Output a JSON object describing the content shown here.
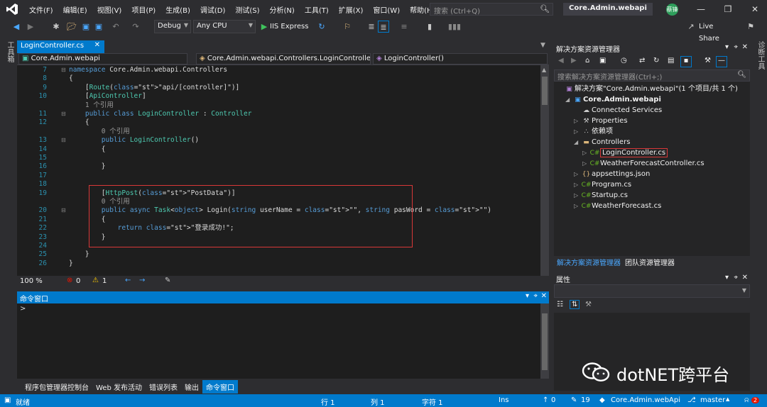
{
  "menu": [
    "文件(F)",
    "编辑(E)",
    "视图(V)",
    "项目(P)",
    "生成(B)",
    "调试(D)",
    "测试(S)",
    "分析(N)",
    "工具(T)",
    "扩展(X)",
    "窗口(W)",
    "帮助(H)"
  ],
  "search": {
    "placeholder": "搜索 (Ctrl+Q)"
  },
  "project_title": "Core.Admin.webapi",
  "avatar": "蔡锋",
  "toolbar": {
    "config": "Debug",
    "platform": "Any CPU",
    "run_label": "IIS Express",
    "live_share": "Live Share"
  },
  "left_strip": "工具箱",
  "right_strip": "诊断工具",
  "editor": {
    "tab": "LoginController.cs",
    "nav_project": "Core.Admin.webapi",
    "nav_class": "Core.Admin.webapi.Controllers.LoginController",
    "nav_member": "LoginController()",
    "lines": [
      {
        "n": "7",
        "text": "namespace Core.Admin.webapi.Controllers"
      },
      {
        "n": "8",
        "text": "{"
      },
      {
        "n": "9",
        "text": "    [Route(\"api/[controller]\")]"
      },
      {
        "n": "10",
        "text": "    [ApiController]"
      },
      {
        "n": "",
        "text": "    1 个引用"
      },
      {
        "n": "11",
        "text": "    public class LoginController : Controller"
      },
      {
        "n": "12",
        "text": "    {"
      },
      {
        "n": "",
        "text": "        0 个引用"
      },
      {
        "n": "13",
        "text": "        public LoginController()"
      },
      {
        "n": "14",
        "text": "        {"
      },
      {
        "n": "15",
        "text": ""
      },
      {
        "n": "16",
        "text": "        }"
      },
      {
        "n": "17",
        "text": ""
      },
      {
        "n": "18",
        "text": ""
      },
      {
        "n": "19",
        "text": "        [HttpPost(\"PostData\")]"
      },
      {
        "n": "",
        "text": "        0 个引用"
      },
      {
        "n": "20",
        "text": "        public async Task<object> Login(string userName = \"\", string pasWord = \"\")"
      },
      {
        "n": "21",
        "text": "        {"
      },
      {
        "n": "22",
        "text": "            return \"登录成功!\";"
      },
      {
        "n": "23",
        "text": "        }"
      },
      {
        "n": "24",
        "text": ""
      },
      {
        "n": "25",
        "text": "    }"
      },
      {
        "n": "26",
        "text": "}"
      }
    ],
    "zoom": "100 %",
    "errors": "0",
    "warnings": "1"
  },
  "command_window": {
    "title": "命令窗口",
    "prompt": ">"
  },
  "bottom_tabs": [
    "程序包管理器控制台",
    "Web 发布活动",
    "错误列表",
    "输出",
    "命令窗口"
  ],
  "solution_explorer": {
    "title": "解决方案资源管理器",
    "search_placeholder": "搜索解决方案资源管理器(Ctrl+;)",
    "items": [
      {
        "label": "解决方案\"Core.Admin.webapi\"(1 个项目/共 1 个)",
        "level": 0,
        "icon": "solution-icon"
      },
      {
        "label": "Core.Admin.webapi",
        "level": 1,
        "icon": "project-icon",
        "bold": true
      },
      {
        "label": "Connected Services",
        "level": 2,
        "icon": "connected-services-icon"
      },
      {
        "label": "Properties",
        "level": 2,
        "icon": "wrench-icon"
      },
      {
        "label": "依赖项",
        "level": 2,
        "icon": "dependencies-icon"
      },
      {
        "label": "Controllers",
        "level": 2,
        "icon": "folder-icon"
      },
      {
        "label": "LoginController.cs",
        "level": 3,
        "icon": "csharp-file-icon"
      },
      {
        "label": "WeatherForecastController.cs",
        "level": 3,
        "icon": "csharp-file-icon"
      },
      {
        "label": "appsettings.json",
        "level": 2,
        "icon": "json-file-icon"
      },
      {
        "label": "Program.cs",
        "level": 2,
        "icon": "csharp-file-icon"
      },
      {
        "label": "Startup.cs",
        "level": 2,
        "icon": "csharp-file-icon"
      },
      {
        "label": "WeatherForecast.cs",
        "level": 2,
        "icon": "csharp-file-icon"
      }
    ],
    "tab_active": "解决方案资源管理器",
    "tab_other": "团队资源管理器"
  },
  "properties": {
    "title": "属性"
  },
  "watermark": "dotNET跨平台",
  "statusbar": {
    "ready": "就绪",
    "line": "行 1",
    "col": "列 1",
    "char": "字符 1",
    "mode": "Ins",
    "up_count": "0",
    "edit_count": "19",
    "repo": "Core.Admin.webApi",
    "branch": "master",
    "notifications": "2"
  },
  "colors": {
    "accent": "#007acc",
    "editor_bg": "#1e1e1e",
    "chrome_bg": "#2d2d30",
    "highlight_box": "#d83838"
  }
}
